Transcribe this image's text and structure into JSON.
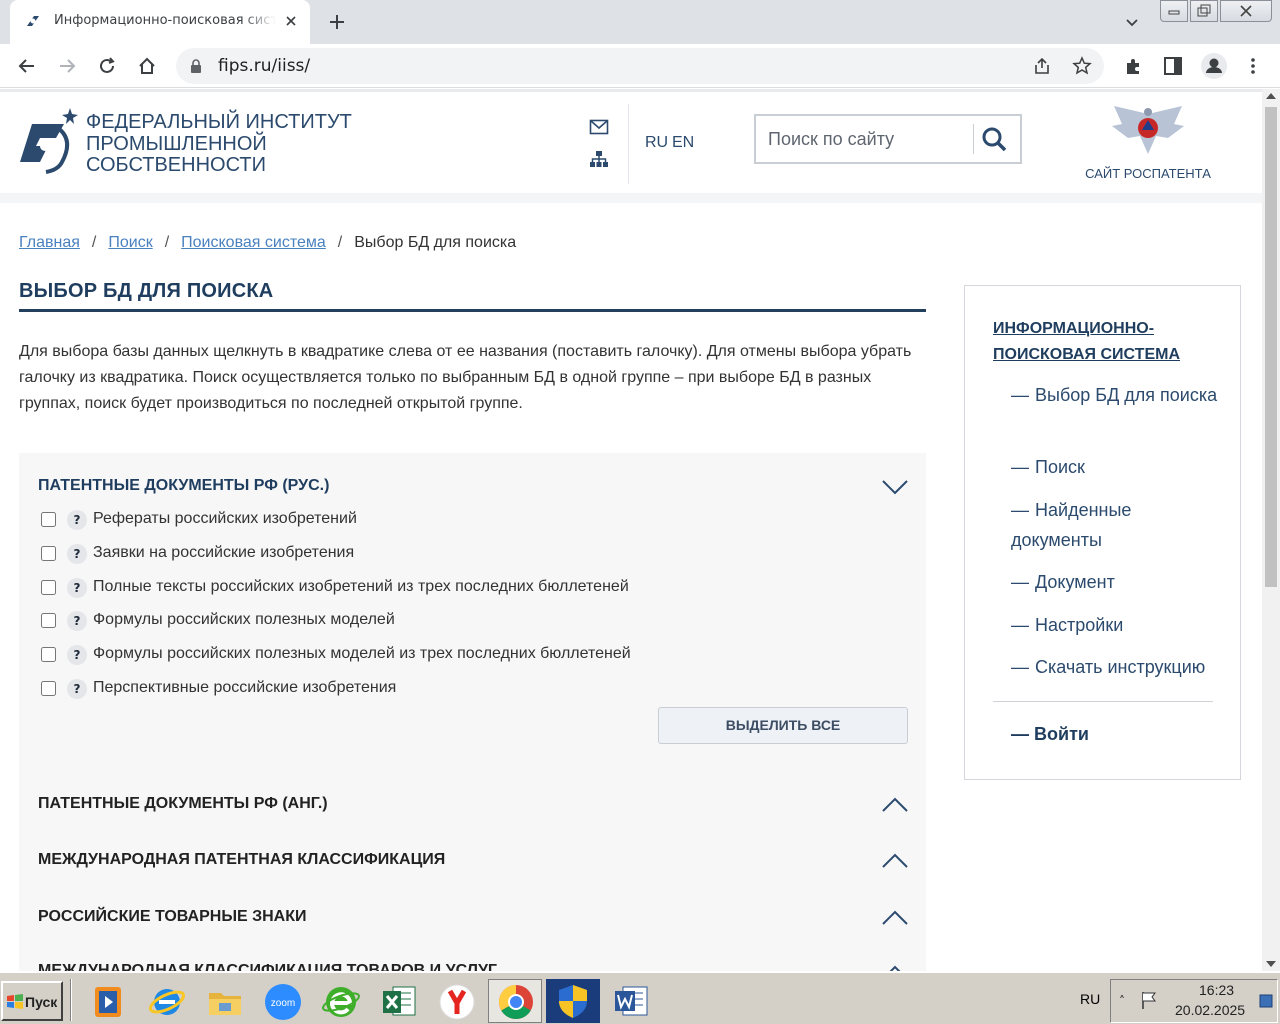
{
  "browser": {
    "tab_title": "Информационно-поисковая система",
    "url": "fips.ru/iiss/",
    "colors": {
      "tabbar": "#dee1e6",
      "omnibox": "#f1f3f4"
    }
  },
  "header": {
    "org_line1": "ФЕДЕРАЛЬНЫЙ ИНСТИТУТ",
    "org_line2": "ПРОМЫШЛЕННОЙ",
    "org_line3": "СОБСТВЕННОСТИ",
    "lang_ru": "RU",
    "lang_en": "EN",
    "search_placeholder": "Поиск по сайту",
    "rospatent_label": "САЙТ РОСПАТЕНТА"
  },
  "breadcrumb": {
    "home": "Главная",
    "search": "Поиск",
    "system": "Поисковая система",
    "current": "Выбор БД для поиска",
    "separator": "/"
  },
  "page_title": "ВЫБОР БД ДЛЯ ПОИСКА",
  "intro": "Для выбора базы данных щелкнуть в квадратике слева от ее названия (поставить галочку). Для отмены выбора убрать галочку из квадратика. Поиск осуществляется только по выбранным БД в одной группе – при выборе БД в разных группах, поиск будет производиться по последней открытой группе.",
  "groups": [
    {
      "title": "ПАТЕНТНЫЕ ДОКУМЕНТЫ РФ (РУС.)",
      "expanded": true,
      "items": [
        {
          "label": "Рефераты российских изобретений",
          "checked": false
        },
        {
          "label": "Заявки на российские изобретения",
          "checked": false
        },
        {
          "label": "Полные тексты российских изобретений из трех последних бюллетеней",
          "checked": false
        },
        {
          "label": "Формулы российских полезных моделей",
          "checked": false
        },
        {
          "label": "Формулы российских полезных моделей из трех последних бюллетеней",
          "checked": false
        },
        {
          "label": "Перспективные российские изобретения",
          "checked": false
        }
      ],
      "select_all": "ВЫДЕЛИТЬ ВСЕ"
    },
    {
      "title": "ПАТЕНТНЫЕ ДОКУМЕНТЫ РФ (АНГ.)",
      "expanded": false
    },
    {
      "title": "МЕЖДУНАРОДНАЯ ПАТЕНТНАЯ КЛАССИФИКАЦИЯ",
      "expanded": false
    },
    {
      "title": "РОССИЙСКИЕ ТОВАРНЫЕ ЗНАКИ",
      "expanded": false
    },
    {
      "title": "МЕЖДУНАРОДНАЯ КЛАССИФИКАЦИЯ ТОВАРОВ И УСЛУГ",
      "expanded": false
    }
  ],
  "help_glyph": "?",
  "sidebar": {
    "title": "ИНФОРМАЦИОННО-ПОИСКОВАЯ СИСТЕМА",
    "dash": "—",
    "items": [
      "Выбор БД для поиска",
      "Поиск",
      "Найденные документы",
      "Документ",
      "Настройки",
      "Скачать инструкцию"
    ],
    "login": "Войти"
  },
  "taskbar": {
    "start_label": "Пуск",
    "apps": [
      "media-player-icon",
      "internet-explorer-icon",
      "file-explorer-icon",
      "zoom-icon",
      "e-browser-icon",
      "excel-icon",
      "yandex-browser-icon",
      "chrome-icon",
      "security-shield-icon",
      "word-icon"
    ],
    "zoom_text": "zoom",
    "keyboard_layout": "RU",
    "time": "16:23",
    "date": "20.02.2025"
  }
}
